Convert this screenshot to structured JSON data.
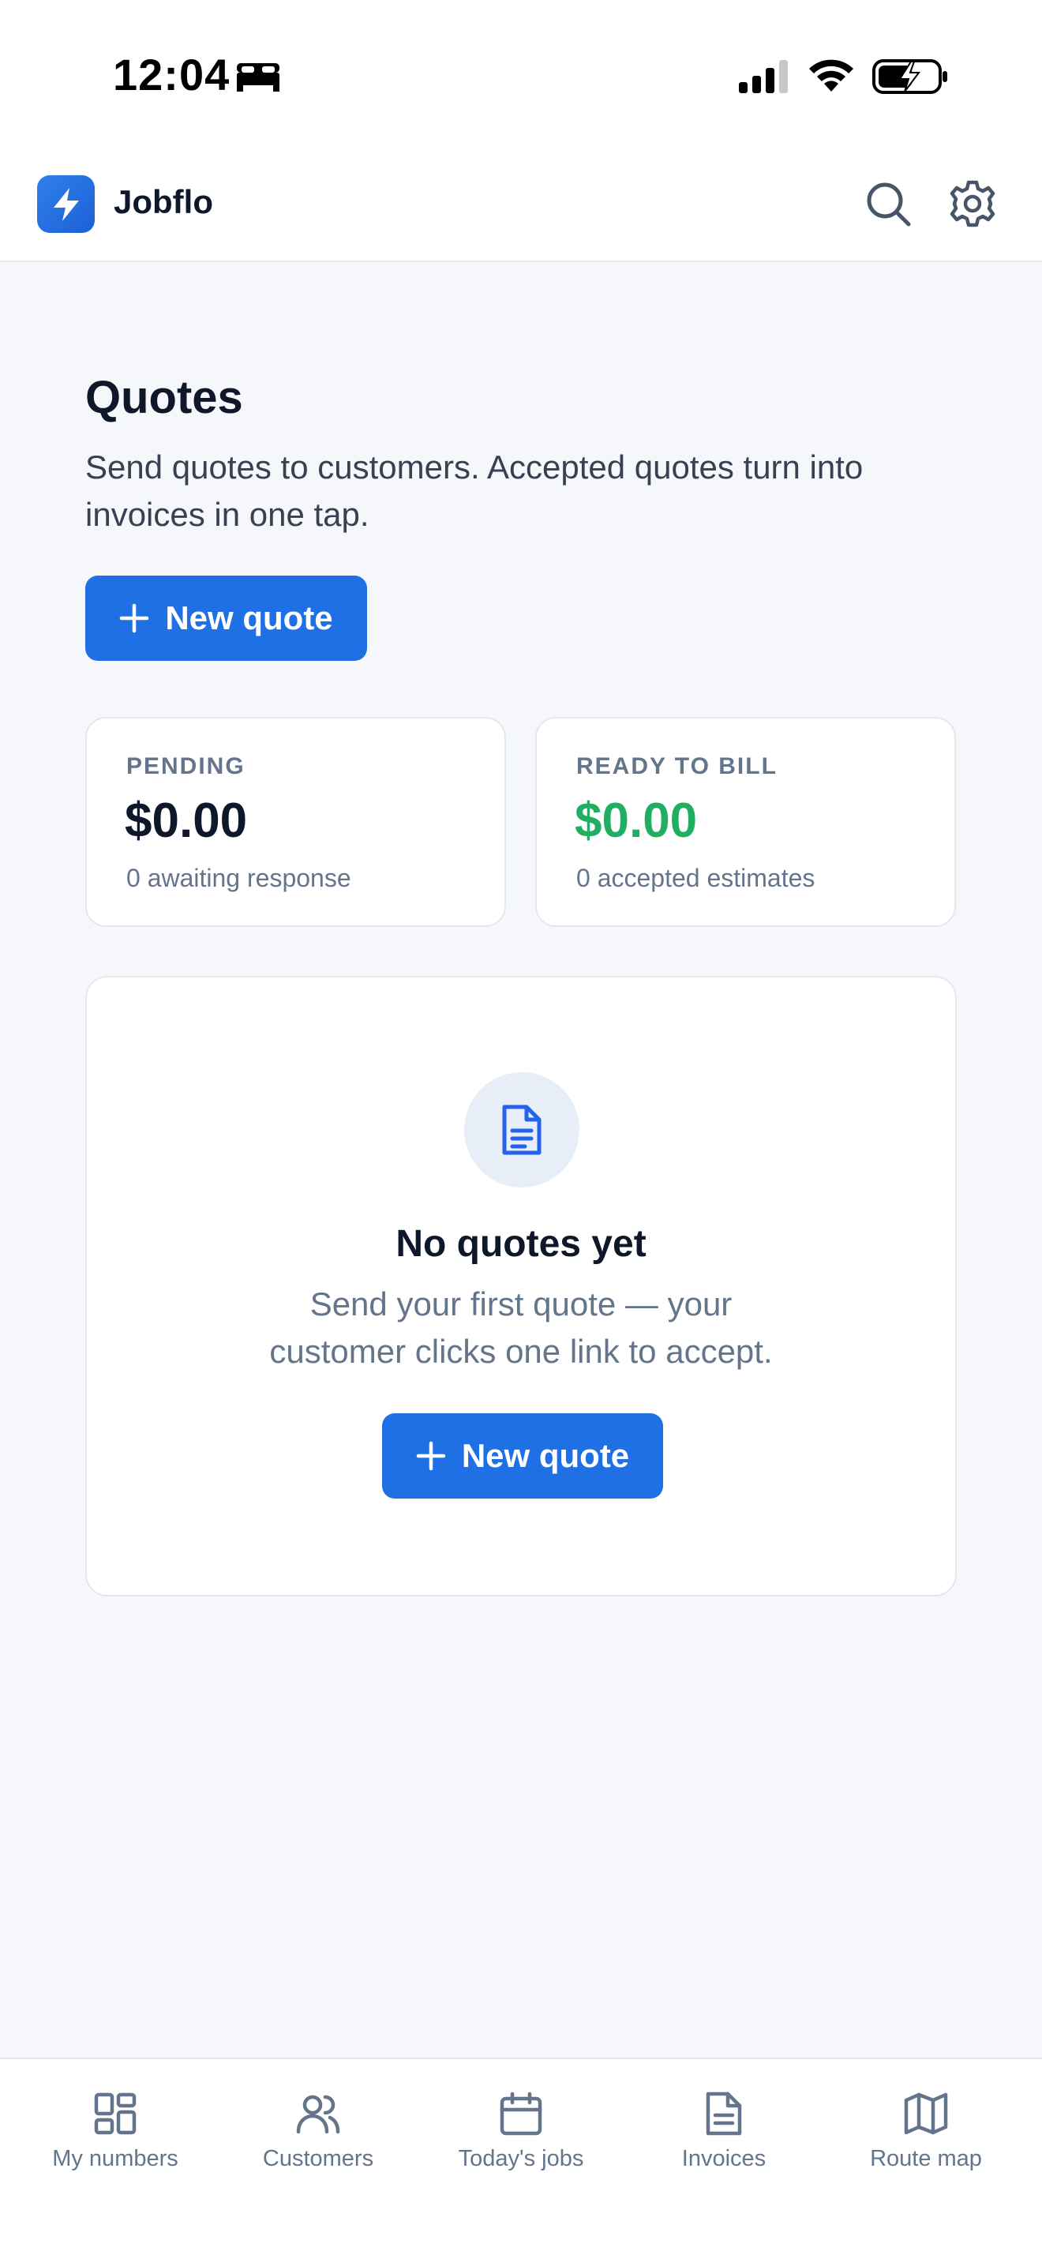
{
  "status_bar": {
    "time": "12:04",
    "icons": [
      "bed-icon",
      "signal-icon",
      "wifi-icon",
      "battery-charging-icon"
    ]
  },
  "app": {
    "brand": "Jobflo",
    "logo_icon": "lightning-bolt-icon",
    "actions": [
      "search-icon",
      "gear-icon"
    ]
  },
  "page": {
    "title": "Quotes",
    "description": "Send quotes to customers. Accepted quotes turn into invoices in one tap.",
    "new_quote_label": "New quote"
  },
  "stats": {
    "pending": {
      "label": "PENDING",
      "value": "$0.00",
      "sub": "0 awaiting response"
    },
    "ready": {
      "label": "READY TO BILL",
      "value": "$0.00",
      "sub": "0 accepted estimates"
    }
  },
  "empty_state": {
    "icon": "document-icon",
    "title": "No quotes yet",
    "description": "Send your first quote — your customer clicks one link to accept.",
    "button_label": "New quote"
  },
  "tabs": [
    {
      "label": "My numbers",
      "icon": "dashboard-icon"
    },
    {
      "label": "Customers",
      "icon": "users-icon"
    },
    {
      "label": "Today's jobs",
      "icon": "calendar-icon"
    },
    {
      "label": "Invoices",
      "icon": "document-icon"
    },
    {
      "label": "Route map",
      "icon": "map-icon"
    }
  ],
  "colors": {
    "primary": "#1f6fe5",
    "accent_green": "#1fae62",
    "background": "#f5f7fa",
    "muted_text": "#64748b"
  }
}
